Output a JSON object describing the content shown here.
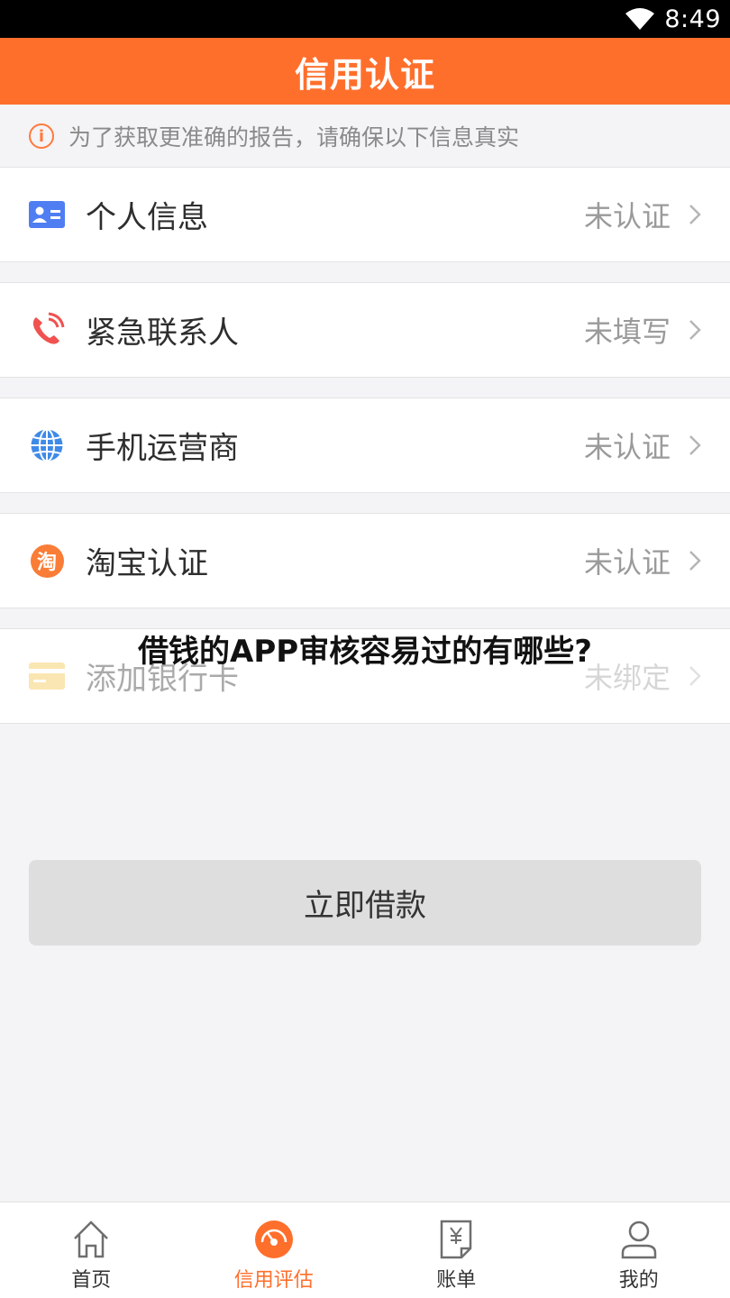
{
  "status_bar": {
    "time": "8:49",
    "wifi_icon": "wifi-icon"
  },
  "header": {
    "title": "信用认证"
  },
  "notice": {
    "icon": "info-icon",
    "text": "为了获取更准确的报告，请确保以下信息真实"
  },
  "items": [
    {
      "icon": "id-card-icon",
      "label": "个人信息",
      "status": "未认证"
    },
    {
      "icon": "phone-icon",
      "label": "紧急联系人",
      "status": "未填写"
    },
    {
      "icon": "globe-icon",
      "label": "手机运营商",
      "status": "未认证"
    },
    {
      "icon": "taobao-icon",
      "icon_text": "淘",
      "label": "淘宝认证",
      "status": "未认证"
    },
    {
      "icon": "bank-card-icon",
      "label": "添加银行卡",
      "status": "未绑定"
    }
  ],
  "overlay": {
    "title": "借钱的APP审核容易过的有哪些?"
  },
  "borrow_button": {
    "label": "立即借款"
  },
  "nav": [
    {
      "icon": "home-icon",
      "label": "首页",
      "active": false
    },
    {
      "icon": "gauge-icon",
      "label": "信用评估",
      "active": true
    },
    {
      "icon": "bill-icon",
      "label": "账单",
      "active": false
    },
    {
      "icon": "user-icon",
      "label": "我的",
      "active": false
    }
  ],
  "colors": {
    "accent": "#ff6f2c",
    "background": "#f4f3f6"
  }
}
